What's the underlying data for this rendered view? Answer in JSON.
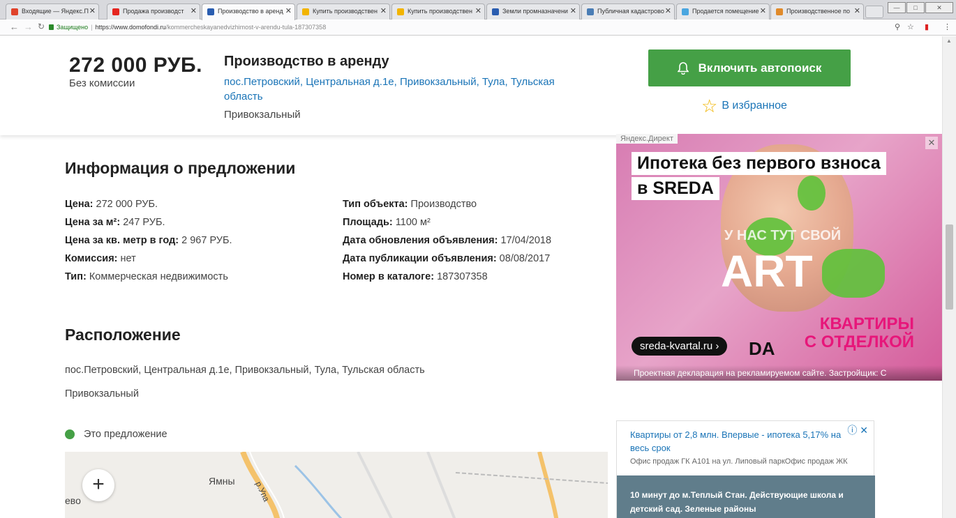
{
  "browser": {
    "tabs": [
      {
        "label": "Входящие — Яндекс.П",
        "color": "#e0432b"
      },
      {
        "label": "Продажа производст",
        "color": "#e52620"
      },
      {
        "label": "Производство в аренд",
        "color": "#2a5db0",
        "active": true
      },
      {
        "label": "Купить производствен",
        "color": "#f2b400"
      },
      {
        "label": "Купить производствен",
        "color": "#f2b400"
      },
      {
        "label": "Земли промназначени",
        "color": "#2a5db0"
      },
      {
        "label": "Публичная кадастрово",
        "color": "#4a7db5"
      },
      {
        "label": "Продается помещение",
        "color": "#4aa6e0"
      },
      {
        "label": "Производственное по",
        "color": "#e08a2a"
      }
    ],
    "url_secure": "Защищено",
    "url_domain": "https://www.domofondi.ru",
    "url_path": "/kommercheskayanedvizhimost-v-arendu-tula-187307358"
  },
  "header": {
    "price": "272 000 РУБ.",
    "commission": "Без комиссии",
    "title": "Производство в аренду",
    "address": "пос.Петровский, Центральная д.1е, Привокзальный, Тула, Тульская область",
    "district": "Привокзальный",
    "autosearch_label": "Включить автопоиск",
    "favorite_label": "В избранное"
  },
  "info": {
    "heading": "Информация о предложении",
    "left": [
      {
        "k": "Цена:",
        "v": " 272 000 РУБ."
      },
      {
        "k": "Цена за м²:",
        "v": " 247 РУБ."
      },
      {
        "k": "Цена за кв. метр в год:",
        "v": " 2 967 РУБ."
      },
      {
        "k": "Комиссия:",
        "v": " нет"
      },
      {
        "k": "Тип:",
        "v": " Коммерческая недвижимость"
      }
    ],
    "right": [
      {
        "k": "Тип объекта:",
        "v": " Производство"
      },
      {
        "k": "Площадь:",
        "v": " 1100 м²"
      },
      {
        "k": "Дата обновления объявления:",
        "v": " 17/04/2018"
      },
      {
        "k": "Дата публикации объявления:",
        "v": " 08/08/2017"
      },
      {
        "k": "Номер в каталоге:",
        "v": " 187307358"
      }
    ]
  },
  "location": {
    "heading": "Расположение",
    "address": "пос.Петровский, Центральная д.1е, Привокзальный, Тула, Тульская область",
    "district": "Привокзальный",
    "legend": "Это предложение",
    "map_labels": [
      "Ямны",
      "р.Упа",
      "ево"
    ],
    "zoom_in": "+"
  },
  "ad_banner": {
    "label": "Яндекс.Директ",
    "headline1": "Ипотека без первого взноса",
    "headline2": "в SREDA",
    "slogan": "У НАС ТУТ СВОЙ",
    "art": "ART",
    "promo": "КВАРТИРЫ С ОТДЕЛКОЙ",
    "link": "sreda-kvartal.ru ›",
    "brand": "DA",
    "disclaimer": "Проектная декларация на рекламируемом сайте. Застройщик: С"
  },
  "ad_text": {
    "title": "Квартиры от 2,8 млн. Впервые - ипотека 5,17% на весь срок",
    "sub": "Офис продаж ГК А101 на ул. Липовый паркОфис продаж ЖК",
    "body": "10 минут до м.Теплый Стан. Действующие школа и детский сад. Зеленые районы"
  }
}
